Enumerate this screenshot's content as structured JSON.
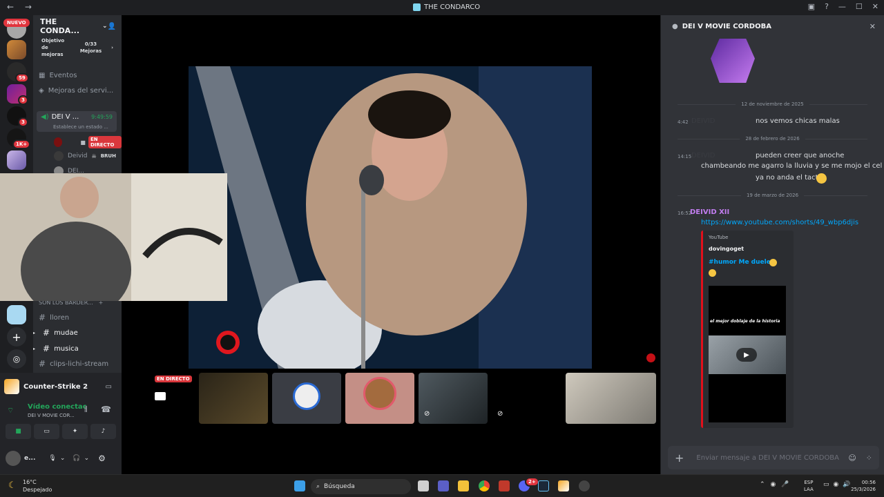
{
  "window": {
    "title": "THE CONDARCO"
  },
  "rail": {
    "new_badge": "NUEVO",
    "badges": [
      "59",
      "3",
      "3",
      "1K+"
    ]
  },
  "server": {
    "name": "THE CONDA...",
    "boost_label": "Objetivo de mejoras",
    "boost_count": "0/33",
    "boost_unit": "Mejoras",
    "events": "Eventos",
    "server_boosts": "Mejoras del servi...",
    "voice_channel": "DEI V ...",
    "voice_timer": "9:49:59",
    "voice_status": "Establece un estado ...",
    "live_label": "EN DIRECTO",
    "members": [
      {
        "name": "Deivid",
        "tag": "BRUH"
      },
      {
        "name": "DEI..."
      }
    ],
    "category": "SON LOS BARDER...",
    "text_channels": [
      "lloren",
      "mudae",
      "musica",
      "clips-lichi-stream"
    ]
  },
  "activity": {
    "game": "Counter-Strike 2",
    "voice_connected": "Vídeo conectac",
    "voice_channel": "DEI V MOVIE COR...",
    "user": "e..."
  },
  "stage": {
    "live_label": "EN DIRECTO"
  },
  "chat": {
    "channel": "DEI V MOVIE CORDOBA",
    "date1": "12 de noviembre de 2025",
    "msg1_time": "4:42",
    "msg1_text": "nos vemos chicas malas",
    "date2": "28 de febrero de 2026",
    "msg2_time": "14:15",
    "msg2_line1": "pueden creer que anoche",
    "msg2_line2": "chambeando me agarro la lluvia y se me mojo el cel",
    "msg2_line3": "ya no anda el tactil",
    "date3": "19 de marzo de 2026",
    "msg3_time": "16:52",
    "msg3_author": "DEIVID XII",
    "msg3_link": "https://www.youtube.com/shorts/49_wbp6djis",
    "embed_provider": "YouTube",
    "embed_author": "dovingoget",
    "embed_title": "#humor Me duele",
    "embed_video_text": "el mejor doblaje de la historia",
    "input_placeholder": "Enviar mensaje a DEI V MOVIE CORDOBA",
    "accent_username": "#c27df0",
    "link_color": "#00a8fc"
  },
  "taskbar": {
    "weather_temp": "16°C",
    "weather_desc": "Despejado",
    "search": "Búsqueda",
    "lang": "ESP",
    "layout": "LAA",
    "time": "00:56",
    "date": "25/3/2026",
    "discord_badge": "2+"
  }
}
